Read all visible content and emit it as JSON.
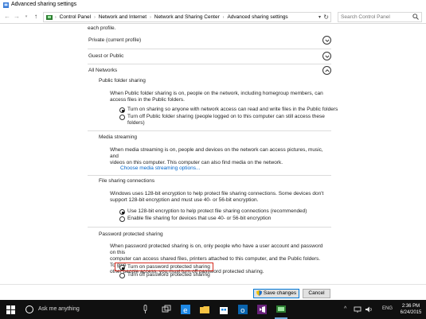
{
  "window": {
    "title": "Advanced sharing settings"
  },
  "address": {
    "crumbs": [
      "Control Panel",
      "Network and Internet",
      "Network and Sharing Center",
      "Advanced sharing settings"
    ],
    "search_placeholder": "Search Control Panel"
  },
  "content": {
    "intro_tail": "each profile.",
    "profiles": [
      {
        "label": "Private (current profile)",
        "state": "collapsed"
      },
      {
        "label": "Guest or Public",
        "state": "collapsed"
      },
      {
        "label": "All Networks",
        "state": "expanded"
      }
    ],
    "public_folder": {
      "title": "Public folder sharing",
      "desc_1": "When Public folder sharing is on, people on the network, including homegroup members, can",
      "desc_2": "access files in the Public folders.",
      "option_on": "Turn on sharing so anyone with network access can read and write files in the Public folders",
      "option_off_1": "Turn off Public folder sharing (people logged on to this computer can still access these",
      "option_off_2": "folders)"
    },
    "media": {
      "title": "Media streaming",
      "desc_1": "When media streaming is on, people and devices on the network can access pictures, music, and",
      "desc_2": "videos on this computer. This computer can also find media on the network.",
      "link": "Choose media streaming options..."
    },
    "file_sharing": {
      "title": "File sharing connections",
      "desc_1": "Windows uses 128-bit encryption to help protect file sharing connections. Some devices don't",
      "desc_2": "support 128-bit encryption and must use 40- or 56-bit encryption.",
      "option_128": "Use 128-bit encryption to help protect file sharing connections (recommended)",
      "option_40": "Enable file sharing for devices that use 40- or 56-bit encryption"
    },
    "password": {
      "title": "Password protected sharing",
      "desc_1": "When password protected sharing is on, only people who have a user account and password on this",
      "desc_2": "computer can access shared files, printers attached to this computer, and the Public folders. To give",
      "desc_3": "other people access, you must turn off password protected sharing.",
      "option_on": "Turn on password protected sharing",
      "option_off": "Turn off password protected sharing"
    }
  },
  "footer": {
    "save_label": "Save changes",
    "cancel_label": "Cancel"
  },
  "taskbar": {
    "search_text": "Ask me anything",
    "language": "ENG",
    "time": "2:36 PM",
    "date": "6/24/2015"
  },
  "colors": {
    "highlight": "#d52b1e",
    "link": "#0066cc",
    "taskbar": "#101010"
  }
}
